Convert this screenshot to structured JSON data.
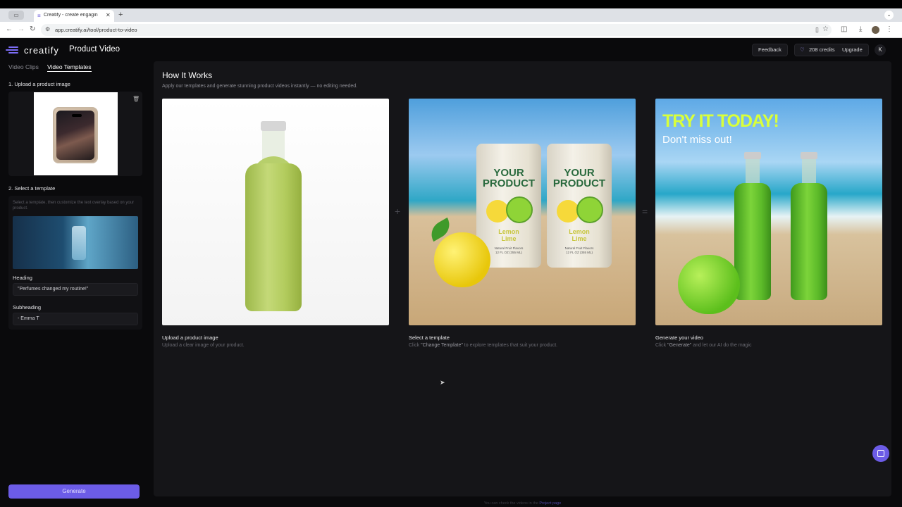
{
  "browser": {
    "tab_title": "Creatify - create engagin",
    "url": "app.creatify.ai/tool/product-to-video"
  },
  "app": {
    "brand": "creatify",
    "page_title": "Product Video",
    "feedback": "Feedback",
    "credits": "208 credits",
    "upgrade": "Upgrade",
    "avatar_initial": "K"
  },
  "sidebar": {
    "tabs": [
      {
        "label": "Video Clips",
        "active": false
      },
      {
        "label": "Video Templates",
        "active": true
      }
    ],
    "step1": "1. Upload a product image",
    "step2": "2. Select a template",
    "template_hint": "Select a template, then customize the text overlay based on your product.",
    "heading_label": "Heading",
    "heading_value": "\"Perfumes changed my routine!\"",
    "subheading_label": "Subheading",
    "subheading_value": "- Emma T",
    "generate": "Generate"
  },
  "main": {
    "title": "How It Works",
    "subtitle": "Apply our templates and generate stunning product videos instantly — no editing needed.",
    "steps": [
      {
        "title": "Upload a product image",
        "desc": "Upload a clear image of your product."
      },
      {
        "title": "Select a template",
        "desc_pre": "Click ",
        "desc_em": "\"Change Template\"",
        "desc_post": " to explore templates that suit your product."
      },
      {
        "title": "Generate your video",
        "desc_pre": "Click ",
        "desc_em": "\"Generate\"",
        "desc_post": " and let our AI do the magic"
      }
    ],
    "plus": "+",
    "equals": "=",
    "can_label_1": "YOUR",
    "can_label_2": "PRODUCT",
    "can_sub_1": "Lemon",
    "can_sub_2": "Lime",
    "can_fine_1": "Natural Fruit Flavors",
    "can_fine_2": "12 FL OZ (355 ML)",
    "try_title": "TRY IT TODAY!",
    "try_sub": "Don't miss out!"
  },
  "footer": {
    "pre": "You can check the videos in the ",
    "link": "Project page"
  },
  "colors": {
    "accent": "#6c5ce7",
    "background": "#0a0a0c",
    "panel": "#151518"
  }
}
